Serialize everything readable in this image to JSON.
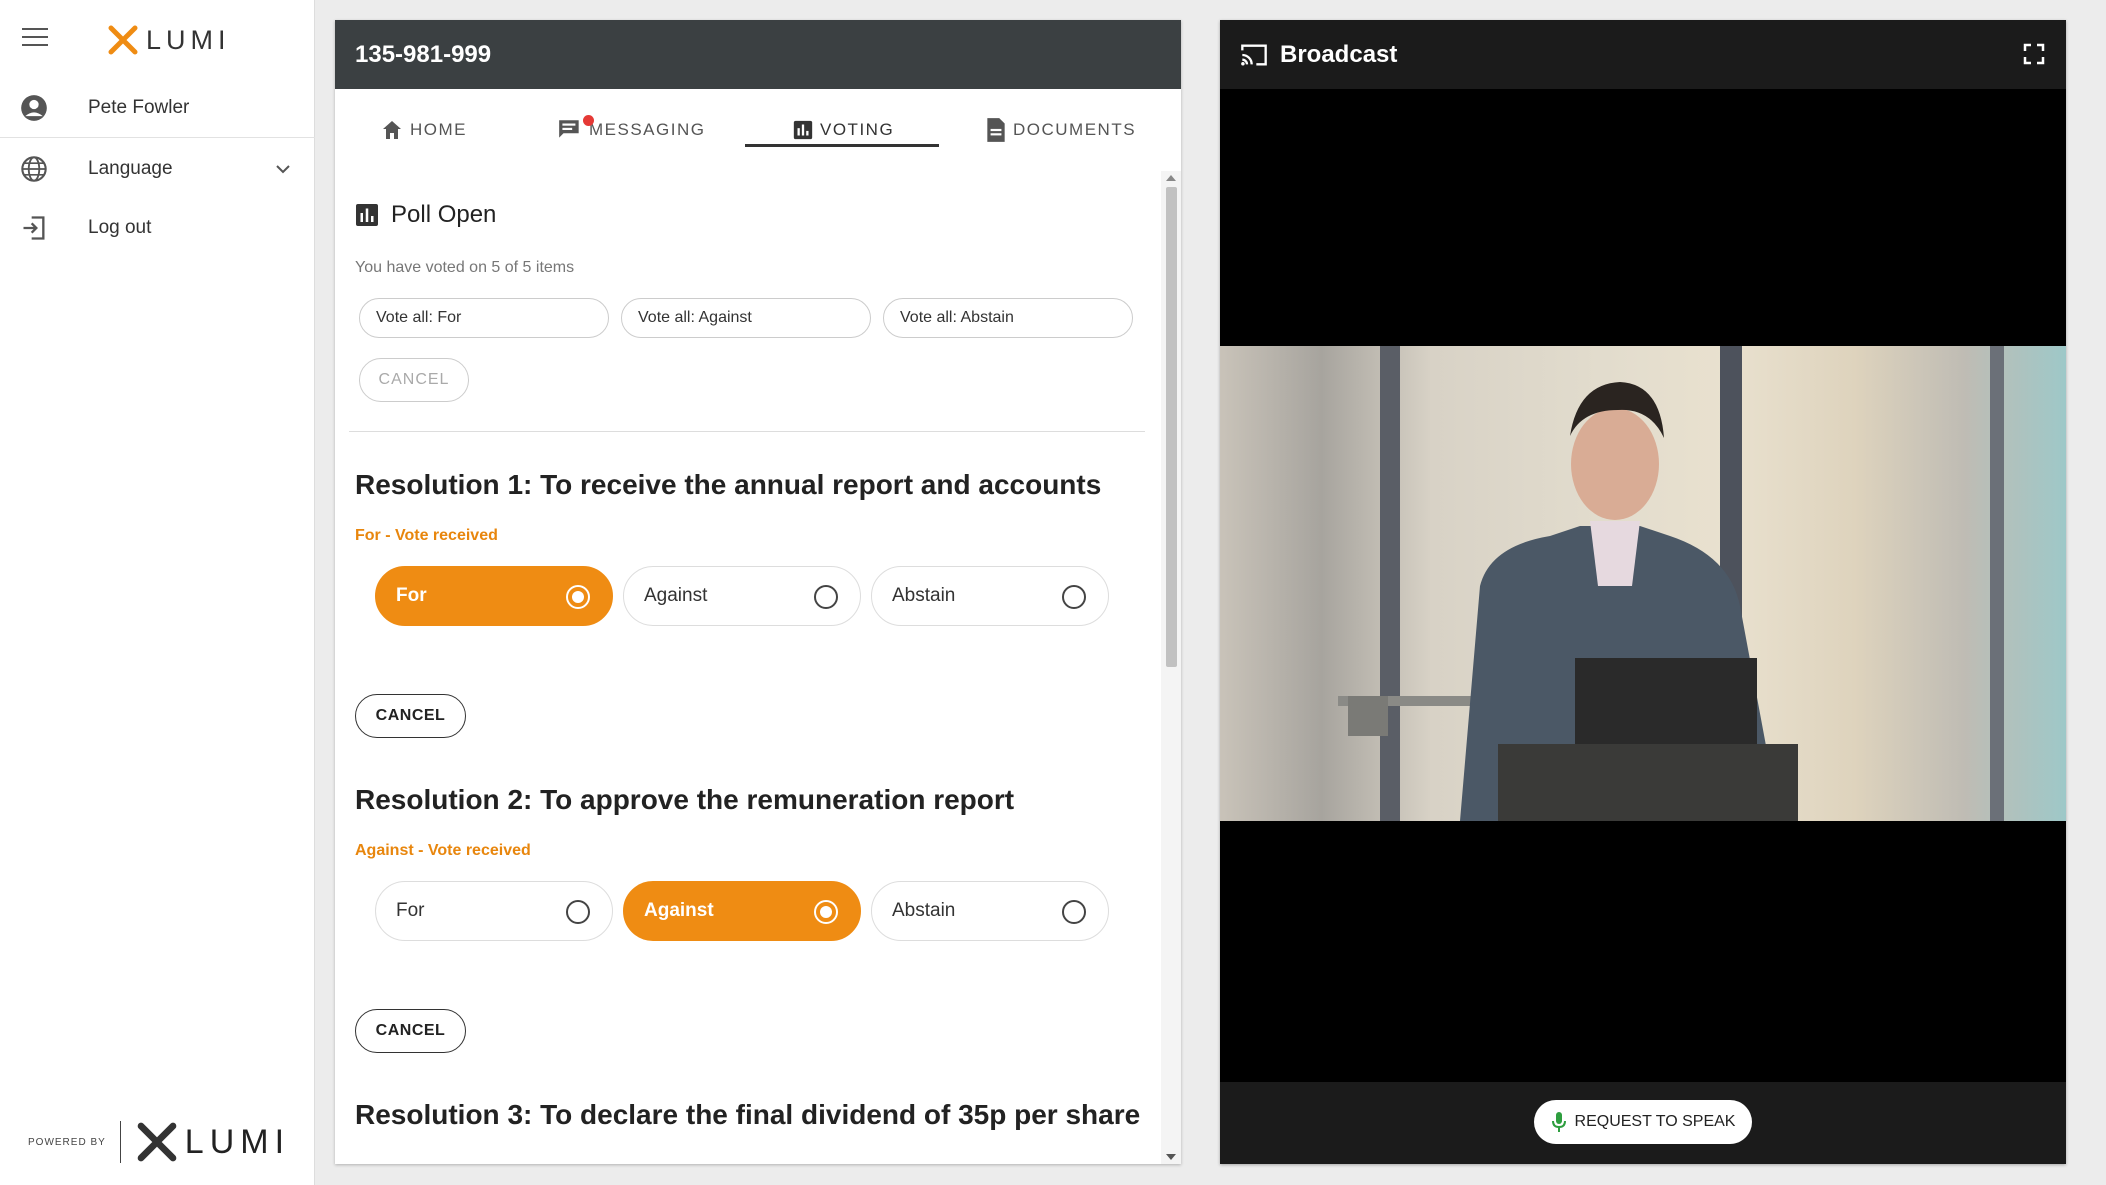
{
  "sidebar": {
    "brand": "LUMI",
    "user_name": "Pete Fowler",
    "language_label": "Language",
    "logout_label": "Log out",
    "powered_by": "POWERED BY",
    "powered_brand": "LUMI"
  },
  "meeting": {
    "id": "135-981-999"
  },
  "tabs": [
    {
      "label": "HOME",
      "icon": "home-icon"
    },
    {
      "label": "MESSAGING",
      "icon": "chat-icon",
      "notification": true
    },
    {
      "label": "VOTING",
      "icon": "bar-chart-icon",
      "active": true
    },
    {
      "label": "DOCUMENTS",
      "icon": "document-icon"
    }
  ],
  "poll": {
    "title": "Poll Open",
    "subtitle": "You have voted on 5 of 5 items",
    "vote_all": [
      "Vote all: For",
      "Vote all: Against",
      "Vote all: Abstain"
    ],
    "cancel_label": "CANCEL"
  },
  "resolutions": [
    {
      "title": "Resolution 1: To receive the annual report and accounts",
      "status": "For - Vote received",
      "options": [
        "For",
        "Against",
        "Abstain"
      ],
      "selected": "For",
      "cancel_label": "CANCEL"
    },
    {
      "title": "Resolution 2: To approve the remuneration report",
      "status": "Against - Vote received",
      "options": [
        "For",
        "Against",
        "Abstain"
      ],
      "selected": "Against",
      "cancel_label": "CANCEL"
    },
    {
      "title": "Resolution 3: To declare the final dividend of 35p per share"
    }
  ],
  "broadcast": {
    "title": "Broadcast",
    "request_label": "REQUEST TO SPEAK"
  },
  "colors": {
    "accent": "#ef8c13",
    "header": "#3b4042",
    "status_text": "#e8860d"
  }
}
